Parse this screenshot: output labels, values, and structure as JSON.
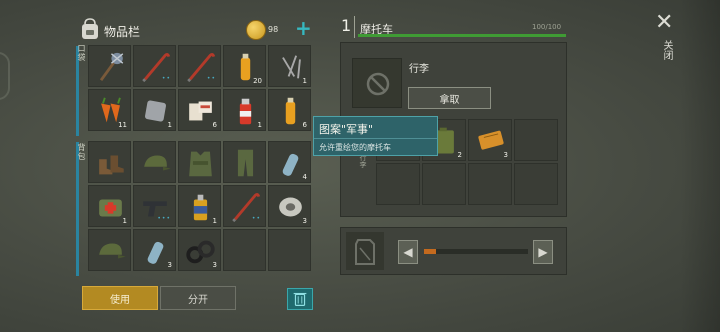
{
  "inventory": {
    "title": "物品栏",
    "coins": "98",
    "add_coin": "+",
    "pocket_label": "口袋",
    "backpack_label": "背包",
    "pocket_slots": [
      {
        "item": "spiked-club",
        "count": "",
        "dots": ""
      },
      {
        "item": "crowbar",
        "count": "",
        "dots": "••"
      },
      {
        "item": "crowbar",
        "count": "",
        "dots": "••"
      },
      {
        "item": "water-bottle",
        "count": "20",
        "dots": ""
      },
      {
        "item": "nails",
        "count": "1",
        "dots": ""
      },
      {
        "item": "carrots",
        "count": "11",
        "dots": ""
      },
      {
        "item": "metal-plate",
        "count": "1",
        "dots": ""
      },
      {
        "item": "bandages",
        "count": "6",
        "dots": ""
      },
      {
        "item": "spray-can",
        "count": "1",
        "dots": ""
      },
      {
        "item": "water-bottle",
        "count": "6",
        "dots": ""
      }
    ],
    "backpack_slots": [
      {
        "item": "boots",
        "count": "",
        "dots": ""
      },
      {
        "item": "military-cap",
        "count": "",
        "dots": ""
      },
      {
        "item": "military-vest",
        "count": "",
        "dots": ""
      },
      {
        "item": "military-pants",
        "count": "",
        "dots": ""
      },
      {
        "item": "plastic-bottle",
        "count": "4",
        "dots": ""
      },
      {
        "item": "medkit-bag",
        "count": "1",
        "dots": ""
      },
      {
        "item": "pistol",
        "count": "",
        "dots": "•••"
      },
      {
        "item": "engine-oil",
        "count": "1",
        "dots": ""
      },
      {
        "item": "crowbar",
        "count": "",
        "dots": "••"
      },
      {
        "item": "wire-spool",
        "count": "3",
        "dots": ""
      },
      {
        "item": "military-cap",
        "count": "",
        "dots": ""
      },
      {
        "item": "plastic-bottle",
        "count": "3",
        "dots": ""
      },
      {
        "item": "rubber-rings",
        "count": "3",
        "dots": ""
      },
      {
        "item": "",
        "count": "",
        "dots": ""
      },
      {
        "item": "",
        "count": "",
        "dots": ""
      }
    ],
    "use_label": "使用",
    "split_label": "分开"
  },
  "vehicle": {
    "number": "1",
    "title": "摩托车",
    "hp_text": "100/100",
    "hp_fraction": 1.0,
    "luggage_label": "行李",
    "take_label": "拿取",
    "trunk_label": "行李",
    "trunk_slots": [
      {
        "item": "",
        "count": ""
      },
      {
        "item": "jerrycan",
        "count": "2"
      },
      {
        "item": "ticket",
        "count": "3"
      },
      {
        "item": "",
        "count": ""
      },
      {
        "item": "",
        "count": ""
      },
      {
        "item": "",
        "count": ""
      },
      {
        "item": "",
        "count": ""
      },
      {
        "item": "",
        "count": ""
      }
    ],
    "fuel_fraction": 0.12,
    "left_arrow": "◀",
    "right_arrow": "▶"
  },
  "tooltip": {
    "title": "图案\"军事\"",
    "description": "允许重绘您的摩托车"
  },
  "close": {
    "icon": "✕",
    "label": "关闭"
  },
  "colors": {
    "accent_blue": "#2a8aa6",
    "use_button": "#b38a22",
    "hp_green": "#3f9b34",
    "fuel_orange": "#c46a1e",
    "tooltip_bg": "#2e6369"
  }
}
